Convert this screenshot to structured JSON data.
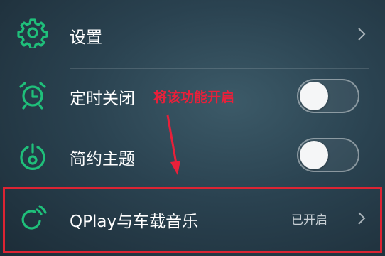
{
  "settings": {
    "items": [
      {
        "label": "设置",
        "icon": "gear-icon"
      },
      {
        "label": "定时关闭",
        "icon": "alarm-clock-icon",
        "toggle": "off"
      },
      {
        "label": "简约主题",
        "icon": "theme-icon",
        "toggle": "off"
      },
      {
        "label": "QPlay与车载音乐",
        "icon": "qplay-icon",
        "status": "已开启"
      }
    ]
  },
  "annotation": {
    "text": "将该功能开启"
  },
  "colors": {
    "icon_green": "#1fbf7a",
    "annotation_red": "#e8203a",
    "highlight_red": "#dc2433"
  }
}
